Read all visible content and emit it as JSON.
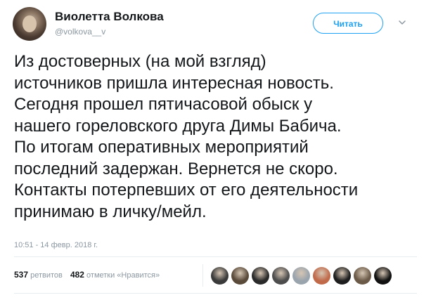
{
  "author": {
    "name": "Виолетта Волкова",
    "handle": "@volkova__v"
  },
  "follow_button": {
    "label": "Читать"
  },
  "tweet": {
    "text": "Из достоверных (на мой взгляд)\nисточников пришла интересная новость.\nСегодня прошел пятичасовой обыск у\nнашего гореловского друга Димы Бабича.\nПо итогам оперативных мероприятий\nпоследний задержан. Вернется не скоро.\nКонтакты потерпевших от его деятельности\nпринимаю в личку/мейл.",
    "timestamp": "10:51 - 14 февр. 2018 г."
  },
  "stats": {
    "retweets_count": "537",
    "retweets_label": "ретвитов",
    "likes_count": "482",
    "likes_label": "отметки «Нравится»"
  },
  "likers": [
    {
      "icon": "avatar-1",
      "color": "#3a3a3a"
    },
    {
      "icon": "avatar-2",
      "color": "#5a4a3a"
    },
    {
      "icon": "avatar-3",
      "color": "#2a2a2a"
    },
    {
      "icon": "avatar-4",
      "color": "#4d4d4d"
    },
    {
      "icon": "avatar-5",
      "color": "#9aa4ad"
    },
    {
      "icon": "avatar-6",
      "color": "#c06a4a"
    },
    {
      "icon": "avatar-7",
      "color": "#1e1e1e"
    },
    {
      "icon": "avatar-8",
      "color": "#6b5a48"
    },
    {
      "icon": "avatar-9",
      "color": "#111111"
    }
  ],
  "colors": {
    "accent": "#1da1f2",
    "muted": "#8b97a1",
    "text": "#14171a"
  }
}
